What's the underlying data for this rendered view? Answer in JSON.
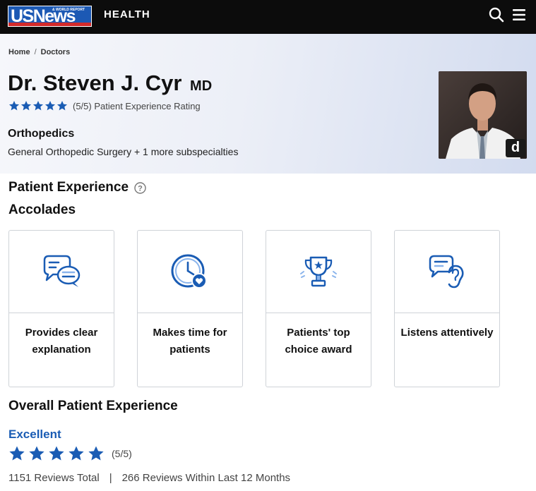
{
  "header": {
    "logo_text": "USNews",
    "logo_small_text": "& WORLD REPORT",
    "section": "HEALTH",
    "icons": {
      "search": "search-icon",
      "menu": "hamburger-menu-icon"
    }
  },
  "breadcrumb": [
    {
      "label": "Home"
    },
    {
      "label": "Doctors"
    }
  ],
  "breadcrumb_separator": "/",
  "doctor": {
    "name": "Dr. Steven J. Cyr",
    "credential": "MD",
    "rating_text": "(5/5) Patient Experience Rating",
    "specialty": "Orthopedics",
    "subspecialties": "General Orthopedic Surgery + 1 more subspecialties",
    "photo_badge": "d",
    "star_rating": 5
  },
  "patient_experience": {
    "title": "Patient Experience",
    "help_icon": "question-circle-icon",
    "accolades_title": "Accolades",
    "accolades": [
      {
        "label": "Provides clear explanation",
        "icon": "chat-bubbles-icon"
      },
      {
        "label": "Makes time for patients",
        "icon": "clock-heart-icon"
      },
      {
        "label": "Patients' top choice award",
        "icon": "trophy-icon"
      },
      {
        "label": "Listens attentively",
        "icon": "ear-speech-icon"
      }
    ]
  },
  "overall": {
    "title": "Overall Patient Experience",
    "grade": "Excellent",
    "rating_text": "(5/5)",
    "star_rating": 5,
    "reviews_total": "1151 Reviews Total",
    "divider": "|",
    "reviews_recent": "266 Reviews Within Last 12 Months"
  },
  "colors": {
    "brand_blue": "#1c59b4",
    "star_blue": "#1a5cb4",
    "accent_red": "#d32a2a",
    "nav_bg": "#0c0c0c"
  }
}
